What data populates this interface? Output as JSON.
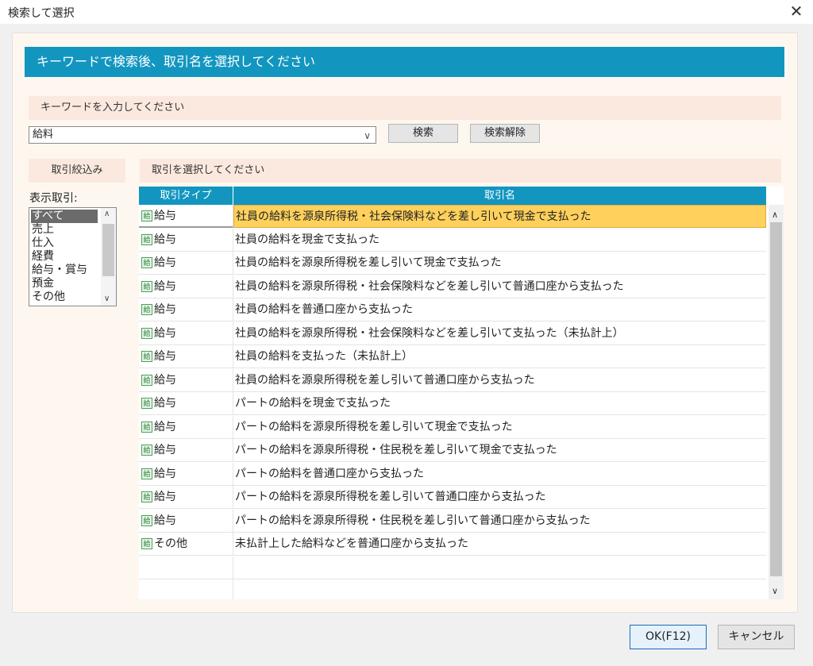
{
  "window": {
    "title": "検索して選択",
    "close_icon": "close-icon"
  },
  "banner": "キーワードで検索後、取引名を選択してください",
  "keyword": {
    "prompt": "キーワードを入力してください",
    "value": "給料",
    "search_label": "検索",
    "clear_label": "検索解除"
  },
  "filter": {
    "heading": "取引絞込み",
    "label": "表示取引:",
    "options": [
      "すべて",
      "売上",
      "仕入",
      "経費",
      "給与・賞与",
      "預金",
      "その他"
    ],
    "selected_index": 0
  },
  "transactions": {
    "heading": "取引を選択してください",
    "columns": [
      "取引タイプ",
      "取引名"
    ],
    "rows": [
      {
        "type": "給与",
        "name": "社員の給料を源泉所得税・社会保険料などを差し引いて現金で支払った",
        "selected": true
      },
      {
        "type": "給与",
        "name": "社員の給料を現金で支払った"
      },
      {
        "type": "給与",
        "name": "社員の給料を源泉所得税を差し引いて現金で支払った"
      },
      {
        "type": "給与",
        "name": "社員の給料を源泉所得税・社会保険料などを差し引いて普通口座から支払った"
      },
      {
        "type": "給与",
        "name": "社員の給料を普通口座から支払った"
      },
      {
        "type": "給与",
        "name": "社員の給料を源泉所得税・社会保険料などを差し引いて支払った（未払計上）"
      },
      {
        "type": "給与",
        "name": "社員の給料を支払った（未払計上）"
      },
      {
        "type": "給与",
        "name": "社員の給料を源泉所得税を差し引いて普通口座から支払った"
      },
      {
        "type": "給与",
        "name": "パートの給料を現金で支払った"
      },
      {
        "type": "給与",
        "name": "パートの給料を源泉所得税を差し引いて現金で支払った"
      },
      {
        "type": "給与",
        "name": "パートの給料を源泉所得税・住民税を差し引いて現金で支払った"
      },
      {
        "type": "給与",
        "name": "パートの給料を普通口座から支払った"
      },
      {
        "type": "給与",
        "name": "パートの給料を源泉所得税を差し引いて普通口座から支払った"
      },
      {
        "type": "給与",
        "name": "パートの給料を源泉所得税・住民税を差し引いて普通口座から支払った"
      },
      {
        "type": "その他",
        "name": "未払計上した給料などを普通口座から支払った"
      }
    ],
    "type_icon": "給"
  },
  "footer": {
    "ok_label": "OK(F12)",
    "cancel_label": "キャンセル"
  },
  "colors": {
    "accent": "#1296c0",
    "selection": "#ffd15c",
    "band": "#fbe9df"
  }
}
